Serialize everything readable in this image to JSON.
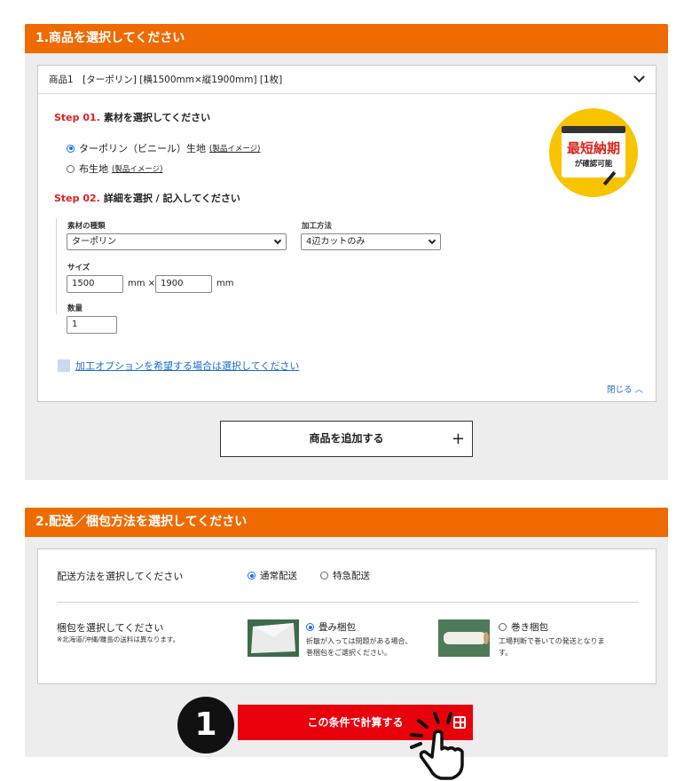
{
  "section1": {
    "title": "1.商品を選択してください",
    "item_header": "商品1　[ターポリン] [横1500mm×縦1900mm] [1枚]",
    "step1": {
      "num": "Step 01.",
      "label": "素材を選択してください"
    },
    "materials": [
      {
        "label": "ターポリン（ビニール）生地",
        "link": "(製品イメージ)",
        "selected": true
      },
      {
        "label": "布生地",
        "link": "(製品イメージ)",
        "selected": false
      }
    ],
    "badge": {
      "line1": "最短納期",
      "line2": "が確認可能"
    },
    "step2": {
      "num": "Step 02.",
      "label": "詳細を選択 / 記入してください"
    },
    "fields": {
      "material_type_label": "素材の種類",
      "material_type_value": "ターポリン",
      "processing_label": "加工方法",
      "processing_value": "4辺カットのみ",
      "size_label": "サイズ",
      "width": "1500",
      "times_unit": "mm ×",
      "height": "1900",
      "mm_unit": "mm",
      "qty_label": "数量",
      "qty": "1"
    },
    "option_link": "加工オプションを希望する場合は選択してください",
    "close_link": "閉じる ︿",
    "add_button": "商品を追加する",
    "add_plus": "+"
  },
  "section2": {
    "title": "2.配送／梱包方法を選択してください",
    "ship_label": "配送方法を選択してください",
    "ship_options": [
      {
        "label": "通常配送",
        "selected": true
      },
      {
        "label": "特急配送",
        "selected": false
      }
    ],
    "pack_label": "梱包を選択してください",
    "pack_note": "※北海道/沖縄/離島の送料は異なります。",
    "pack_options": [
      {
        "label": "畳み梱包",
        "selected": true,
        "desc1": "折皺が入っては問題がある場合、",
        "desc2": "巻梱包をご選択ください。"
      },
      {
        "label": "巻き梱包",
        "selected": false,
        "desc1": "工場判断で巻いての発送となりま",
        "desc2": "す。"
      }
    ]
  },
  "calc_button": "この条件で計算する",
  "step_marker": "1",
  "colors": {
    "accent": "#ef6a00",
    "cta": "#e8000b",
    "link": "#1a6fd0",
    "badge": "#f8c400"
  }
}
